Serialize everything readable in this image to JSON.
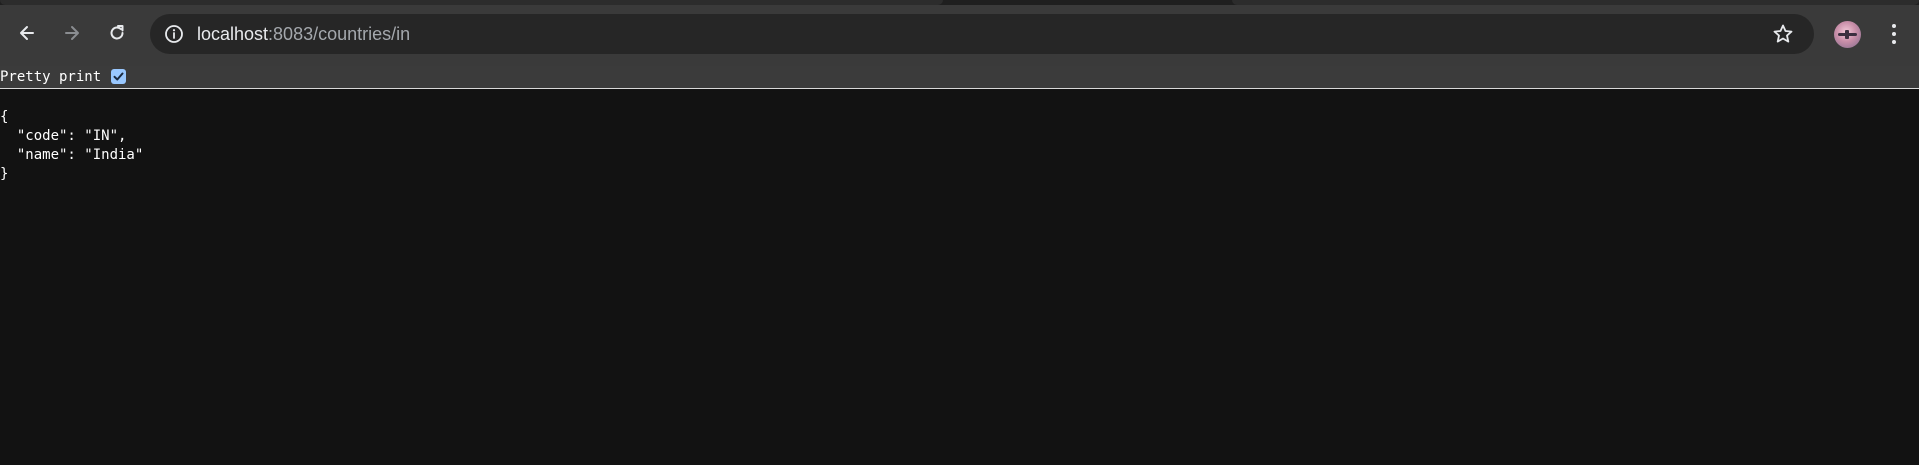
{
  "browser": {
    "url_host": "localhost",
    "url_path": ":8083/countries/in",
    "icons": {
      "back": "arrow-left-icon",
      "forward": "arrow-right-icon",
      "reload": "reload-icon",
      "site_info": "info-icon",
      "bookmark": "star-icon",
      "profile": "avatar",
      "menu": "kebab-menu-icon"
    },
    "colors": {
      "toolbar": "#3a3a3a",
      "omnibox": "#262626",
      "page_background": "#121212"
    }
  },
  "viewer": {
    "pretty_print_label": "Pretty print",
    "pretty_print_checked": true,
    "json_lines": [
      "{",
      "  \"code\": \"IN\",",
      "  \"name\": \"India\"",
      "}"
    ]
  }
}
